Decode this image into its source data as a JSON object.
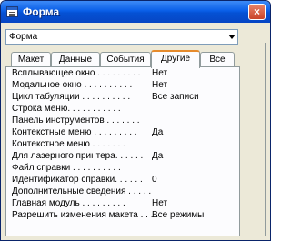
{
  "window": {
    "title": "Форма",
    "close_glyph": "×"
  },
  "combo": {
    "value": "Форма"
  },
  "tabs": [
    {
      "label": "Макет",
      "active": false
    },
    {
      "label": "Данные",
      "active": false
    },
    {
      "label": "События",
      "active": false
    },
    {
      "label": "Другие",
      "active": true
    },
    {
      "label": "Все",
      "active": false
    }
  ],
  "properties": [
    {
      "label": "Всплывающее окно . . . . . . . . .",
      "value": "Нет"
    },
    {
      "label": "Модальное окно . . . . . . . . . .",
      "value": "Нет"
    },
    {
      "label": "Цикл табуляции . . . . . . . . . .",
      "value": "Все записи"
    },
    {
      "label": "Строка меню. . . . . . . . . . .",
      "value": ""
    },
    {
      "label": "Панель инструментов . . . . . . .",
      "value": ""
    },
    {
      "label": "Контекстные меню . . . . . . . . .",
      "value": "Да"
    },
    {
      "label": "Контекстное меню . . . . . . .",
      "value": ""
    },
    {
      "label": "Для лазерного принтера. . . . . .",
      "value": "Да"
    },
    {
      "label": "Файл справки . . . . . . . . . .",
      "value": ""
    },
    {
      "label": "Идентификатор справки. . . . . .",
      "value": "0"
    },
    {
      "label": "Дополнительные сведения . . . . .",
      "value": ""
    },
    {
      "label": "Главная модуль . . . . . . . . .",
      "value": "Нет"
    },
    {
      "label": "Разрешить изменения макета . . . .",
      "value": "Все режимы"
    }
  ]
}
